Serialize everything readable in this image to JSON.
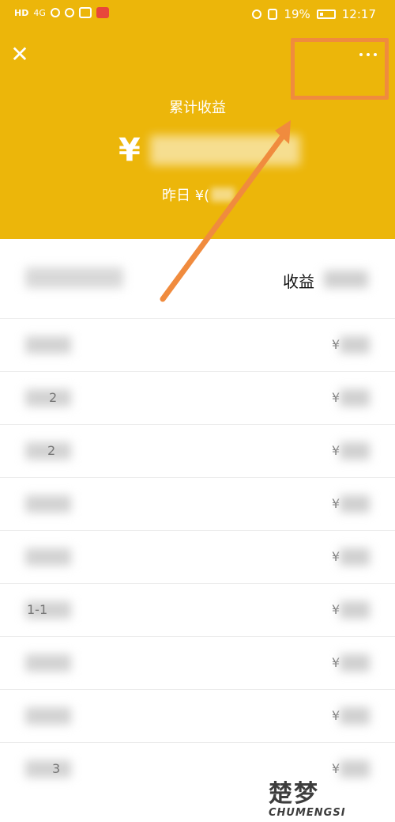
{
  "status_bar": {
    "left_badge": "HD",
    "network": "4G",
    "battery": "19%",
    "time": "12:17"
  },
  "header": {
    "title": "累计收益",
    "total_prefix": "¥",
    "yesterday_prefix": "昨日 ¥("
  },
  "list_header": {
    "income_label": "收益"
  },
  "rows": [
    {
      "date_fragment": "",
      "amount_prefix": "¥"
    },
    {
      "date_fragment": "2",
      "amount_prefix": "¥"
    },
    {
      "date_fragment": "2",
      "amount_prefix": "¥"
    },
    {
      "date_fragment": "",
      "amount_prefix": "¥"
    },
    {
      "date_fragment": "",
      "amount_prefix": "¥"
    },
    {
      "date_fragment": "1-1",
      "amount_prefix": "¥"
    },
    {
      "date_fragment": "",
      "amount_prefix": "¥"
    },
    {
      "date_fragment": "",
      "amount_prefix": "¥"
    },
    {
      "date_fragment": "3",
      "amount_prefix": "¥"
    }
  ],
  "watermark": {
    "title": "楚梦",
    "subtitle": "CHUMENGSI"
  },
  "colors": {
    "header_bg": "#ecb60a",
    "highlight": "#f08b3e"
  }
}
